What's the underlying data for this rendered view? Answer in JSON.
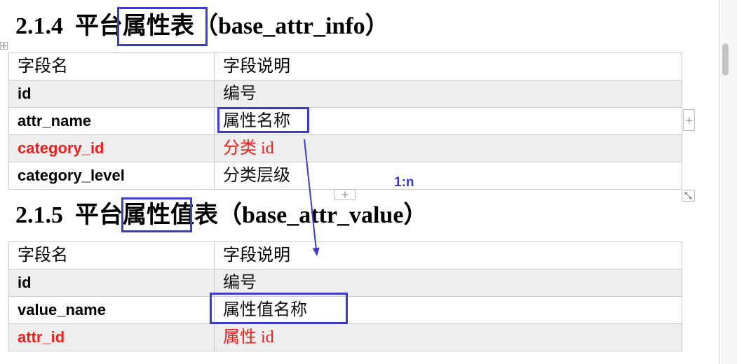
{
  "colors": {
    "annotation": "#3c3cc8",
    "emphasis": "#e8201c",
    "alt_row": "#eeeeee",
    "border": "#c9c9c9"
  },
  "sections": [
    {
      "number": "2.1.4",
      "prefix": "平台",
      "highlight": "属性表",
      "suffix": "（base_attr_info）",
      "table": {
        "header": {
          "name": "字段名",
          "desc": "字段说明"
        },
        "rows": [
          {
            "name": "id",
            "desc": "编号"
          },
          {
            "name": "attr_name",
            "desc": "属性名称",
            "boxed": true
          },
          {
            "name": "category_id",
            "desc": "分类 id",
            "color": "#e8201c"
          },
          {
            "name": "category_level",
            "desc": "分类层级"
          }
        ]
      }
    },
    {
      "number": "2.1.5",
      "prefix": "平台",
      "highlight": "属性值",
      "suffix": "表（base_attr_value）",
      "table": {
        "header": {
          "name": "字段名",
          "desc": "字段说明"
        },
        "rows": [
          {
            "name": "id",
            "desc": "编号"
          },
          {
            "name": "value_name",
            "desc": "属性值名称",
            "boxed": true
          },
          {
            "name": "attr_id",
            "desc": "属性 id",
            "color": "#e8201c"
          }
        ]
      }
    }
  ],
  "annotations": {
    "relation_label": "1:n"
  },
  "editor_controls": {
    "move_handle_icon": "move-icon",
    "insert_column_icon": "plus-icon",
    "insert_row_icon": "plus-icon",
    "resize_handle_icon": "resize-icon"
  }
}
